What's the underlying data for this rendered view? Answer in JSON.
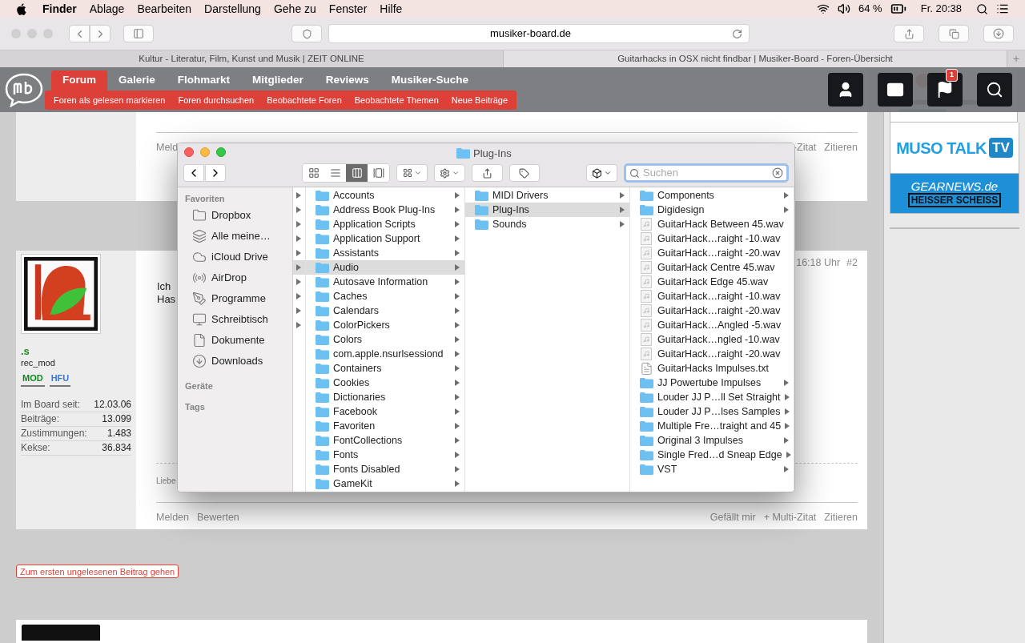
{
  "menubar": {
    "app": "Finder",
    "menus": [
      "Ablage",
      "Bearbeiten",
      "Darstellung",
      "Gehe zu",
      "Fenster",
      "Hilfe"
    ],
    "battery": "64 %",
    "clock": "Fr. 20:38"
  },
  "browser": {
    "address": "musiker-board.de",
    "new_tab": "+",
    "tabs": [
      {
        "title": "Kultur - Literatur, Film, Kunst und Musik | ZEIT ONLINE",
        "selected": false
      },
      {
        "title": "Guitarhacks in OSX nicht findbar | Musiker-Board - Foren-Übersicht",
        "selected": true
      }
    ]
  },
  "site_nav": {
    "items": [
      {
        "label": "Forum",
        "selected": true
      },
      {
        "label": "Galerie",
        "selected": false
      },
      {
        "label": "Flohmarkt",
        "selected": false
      },
      {
        "label": "Mitglieder",
        "selected": false
      },
      {
        "label": "Reviews",
        "selected": false
      },
      {
        "label": "Musiker-Suche",
        "selected": false
      }
    ],
    "subnav": [
      "Foren als gelesen markieren",
      "Foren durchsuchen",
      "Beobachtete Foren",
      "Beobachtete Themen",
      "Neue Beiträge"
    ],
    "notification_count": "1"
  },
  "post_1": {
    "actions_left": [
      "Meld"
    ],
    "actions_right": [
      "-Zitat",
      "Zitieren"
    ]
  },
  "post_2": {
    "username": ".s",
    "title": "rec_mod",
    "badges": [
      "MOD",
      "HFU"
    ],
    "stats": [
      {
        "label": "Im Board seit:",
        "value": "12.03.06"
      },
      {
        "label": "Beiträge:",
        "value": "13.099"
      },
      {
        "label": "Zustimmungen:",
        "value": "1.483"
      },
      {
        "label": "Kekse:",
        "value": "36.834"
      }
    ],
    "body": [
      "Ich",
      "Has"
    ],
    "date": "16:18 Uhr",
    "number": "#2",
    "signature": "Liebe",
    "actions_left": [
      "Melden",
      "Bewerten"
    ],
    "actions_right": [
      "Gefällt mir",
      "+ Multi-Zitat",
      "Zitieren"
    ]
  },
  "unread_button": "Zum ersten ungelesenen Beitrag gehen",
  "ads": {
    "muso_talk": "MUSO TALK",
    "muso_tv": "TV",
    "gearnews": "GEARNEWS.de",
    "gearnews_slogan": "HEISSER SCHEISS"
  },
  "finder": {
    "title": "Plug-Ins",
    "search_placeholder": "Suchen",
    "view_modes": [
      {
        "kind": "icons",
        "selected": false
      },
      {
        "kind": "list",
        "selected": false
      },
      {
        "kind": "columns",
        "selected": true
      },
      {
        "kind": "coverflow",
        "selected": false
      }
    ],
    "sidebar": [
      {
        "heading": "Favoriten",
        "items": [
          {
            "label": "Dropbox",
            "kind": "folder"
          },
          {
            "label": "Alle meine…",
            "kind": "stack"
          },
          {
            "label": "iCloud Drive",
            "kind": "cloud"
          },
          {
            "label": "AirDrop",
            "kind": "airdrop"
          },
          {
            "label": "Programme",
            "kind": "apps"
          },
          {
            "label": "Schreibtisch",
            "kind": "desktop"
          },
          {
            "label": "Dokumente",
            "kind": "document"
          },
          {
            "label": "Downloads",
            "kind": "download"
          }
        ]
      },
      {
        "heading": "Geräte"
      },
      {
        "heading": "Tags"
      }
    ],
    "previous_column": [
      {
        "selected": false
      },
      {
        "selected": false
      },
      {
        "selected": false
      },
      {
        "selected": false
      },
      {
        "selected": false
      },
      {
        "selected": true
      },
      {
        "selected": false
      },
      {
        "selected": false
      },
      {
        "selected": false
      },
      {
        "selected": false
      }
    ],
    "columns": [
      [
        {
          "name": "Accounts",
          "kind": "folder",
          "has_children": true,
          "selected": false
        },
        {
          "name": "Address Book Plug-Ins",
          "kind": "folder",
          "has_children": true,
          "selected": false
        },
        {
          "name": "Application Scripts",
          "kind": "folder",
          "has_children": true,
          "selected": false
        },
        {
          "name": "Application Support",
          "kind": "folder",
          "has_children": true,
          "selected": false
        },
        {
          "name": "Assistants",
          "kind": "folder",
          "has_children": true,
          "selected": false
        },
        {
          "name": "Audio",
          "kind": "folder",
          "has_children": true,
          "selected": true
        },
        {
          "name": "Autosave Information",
          "kind": "folder",
          "has_children": true,
          "selected": false
        },
        {
          "name": "Caches",
          "kind": "folder",
          "has_children": true,
          "selected": false
        },
        {
          "name": "Calendars",
          "kind": "folder",
          "has_children": true,
          "selected": false
        },
        {
          "name": "ColorPickers",
          "kind": "folder",
          "has_children": true,
          "selected": false
        },
        {
          "name": "Colors",
          "kind": "folder",
          "has_children": true,
          "selected": false
        },
        {
          "name": "com.apple.nsurlsessiond",
          "kind": "folder",
          "has_children": true,
          "selected": false
        },
        {
          "name": "Containers",
          "kind": "folder",
          "has_children": true,
          "selected": false
        },
        {
          "name": "Cookies",
          "kind": "folder",
          "has_children": true,
          "selected": false
        },
        {
          "name": "Dictionaries",
          "kind": "folder",
          "has_children": true,
          "selected": false
        },
        {
          "name": "Facebook",
          "kind": "folder",
          "has_children": true,
          "selected": false
        },
        {
          "name": "Favoriten",
          "kind": "folder",
          "has_children": true,
          "selected": false
        },
        {
          "name": "FontCollections",
          "kind": "folder",
          "has_children": true,
          "selected": false
        },
        {
          "name": "Fonts",
          "kind": "folder",
          "has_children": true,
          "selected": false
        },
        {
          "name": "Fonts Disabled",
          "kind": "folder",
          "has_children": true,
          "selected": false
        },
        {
          "name": "GameKit",
          "kind": "folder",
          "has_children": true,
          "selected": false
        }
      ],
      [
        {
          "name": "MIDI Drivers",
          "kind": "folder",
          "has_children": true,
          "selected": false
        },
        {
          "name": "Plug-Ins",
          "kind": "folder",
          "has_children": true,
          "selected": true
        },
        {
          "name": "Sounds",
          "kind": "folder",
          "has_children": true,
          "selected": false
        }
      ],
      [
        {
          "name": "Components",
          "kind": "folder",
          "has_children": true,
          "selected": false
        },
        {
          "name": "Digidesign",
          "kind": "folder",
          "has_children": true,
          "selected": false
        },
        {
          "name": "GuitarHack Between 45.wav",
          "kind": "audio",
          "has_children": false,
          "selected": false
        },
        {
          "name": "GuitarHack…raight -10.wav",
          "kind": "audio",
          "has_children": false,
          "selected": false
        },
        {
          "name": "GuitarHack…raight -20.wav",
          "kind": "audio",
          "has_children": false,
          "selected": false
        },
        {
          "name": "GuitarHack Centre 45.wav",
          "kind": "audio",
          "has_children": false,
          "selected": false
        },
        {
          "name": "GuitarHack Edge 45.wav",
          "kind": "audio",
          "has_children": false,
          "selected": false
        },
        {
          "name": "GuitarHack…raight -10.wav",
          "kind": "audio",
          "has_children": false,
          "selected": false
        },
        {
          "name": "GuitarHack…raight -20.wav",
          "kind": "audio",
          "has_children": false,
          "selected": false
        },
        {
          "name": "GuitarHack…Angled -5.wav",
          "kind": "audio",
          "has_children": false,
          "selected": false
        },
        {
          "name": "GuitarHack…ngled -10.wav",
          "kind": "audio",
          "has_children": false,
          "selected": false
        },
        {
          "name": "GuitarHack…raight -20.wav",
          "kind": "audio",
          "has_children": false,
          "selected": false
        },
        {
          "name": "GuitarHacks Impulses.txt",
          "kind": "text",
          "has_children": false,
          "selected": false
        },
        {
          "name": "JJ Powertube Impulses",
          "kind": "folder",
          "has_children": true,
          "selected": false
        },
        {
          "name": "Louder JJ P…ll Set Straight",
          "kind": "folder",
          "has_children": true,
          "selected": false
        },
        {
          "name": "Louder JJ P…lses Samples",
          "kind": "folder",
          "has_children": true,
          "selected": false
        },
        {
          "name": "Multiple Fre…traight and 45",
          "kind": "folder",
          "has_children": true,
          "selected": false
        },
        {
          "name": "Original 3 Impulses",
          "kind": "folder",
          "has_children": true,
          "selected": false
        },
        {
          "name": "Single Fred…d Sneap Edge",
          "kind": "folder",
          "has_children": true,
          "selected": false
        },
        {
          "name": "VST",
          "kind": "folder",
          "has_children": true,
          "selected": false
        }
      ]
    ]
  }
}
